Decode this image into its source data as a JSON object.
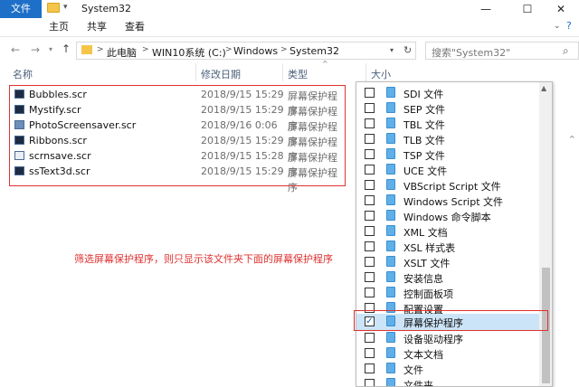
{
  "window": {
    "title": "System32",
    "minimize": "—",
    "maximize": "☐",
    "close": "✕"
  },
  "ribbon": {
    "tabs": [
      "文件",
      "主页",
      "共享",
      "查看"
    ]
  },
  "address": {
    "crumbs": [
      "此电脑",
      "WIN10系统 (C:)",
      "Windows",
      "System32"
    ],
    "search_placeholder": "搜索\"System32\""
  },
  "columns": {
    "name": "名称",
    "date": "修改日期",
    "type": "类型",
    "size": "大小"
  },
  "files": [
    {
      "name": "Bubbles.scr",
      "date": "2018/9/15 15:29",
      "type": "屏幕保护程序"
    },
    {
      "name": "Mystify.scr",
      "date": "2018/9/15 15:29",
      "type": "屏幕保护程序"
    },
    {
      "name": "PhotoScreensaver.scr",
      "date": "2018/9/16 0:06",
      "type": "屏幕保护程序"
    },
    {
      "name": "Ribbons.scr",
      "date": "2018/9/15 15:29",
      "type": "屏幕保护程序"
    },
    {
      "name": "scrnsave.scr",
      "date": "2018/9/15 15:28",
      "type": "屏幕保护程序"
    },
    {
      "name": "ssText3d.scr",
      "date": "2018/9/15 15:29",
      "type": "屏幕保护程序"
    }
  ],
  "annotation": "筛选屏幕保护程序，则只显示该文件夹下面的屏幕保护程序",
  "filter_items": [
    {
      "label": "SDI 文件",
      "checked": false
    },
    {
      "label": "SEP 文件",
      "checked": false
    },
    {
      "label": "TBL 文件",
      "checked": false
    },
    {
      "label": "TLB 文件",
      "checked": false
    },
    {
      "label": "TSP 文件",
      "checked": false
    },
    {
      "label": "UCE 文件",
      "checked": false
    },
    {
      "label": "VBScript Script 文件",
      "checked": false
    },
    {
      "label": "Windows Script 文件",
      "checked": false
    },
    {
      "label": "Windows 命令脚本",
      "checked": false
    },
    {
      "label": "XML 文档",
      "checked": false
    },
    {
      "label": "XSL 样式表",
      "checked": false
    },
    {
      "label": "XSLT 文件",
      "checked": false
    },
    {
      "label": "安装信息",
      "checked": false
    },
    {
      "label": "控制面板项",
      "checked": false
    },
    {
      "label": "配置设置",
      "checked": false
    },
    {
      "label": "屏幕保护程序",
      "checked": true
    },
    {
      "label": "设备驱动程序",
      "checked": false
    },
    {
      "label": "文本文档",
      "checked": false
    },
    {
      "label": "文件",
      "checked": false
    },
    {
      "label": "文件夹",
      "checked": false
    }
  ],
  "colors": {
    "accent": "#1e6fc7",
    "highlight": "#e03131",
    "selected_row": "#cce4f7"
  }
}
